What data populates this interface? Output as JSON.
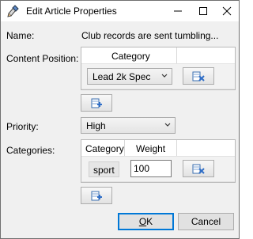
{
  "window": {
    "title": "Edit Article Properties",
    "controls": {
      "minimize": "minimize",
      "maximize": "maximize",
      "close": "close"
    }
  },
  "form": {
    "name_label": "Name:",
    "name_value": "Club records are sent tumbling...",
    "content_position_label": "Content Position:",
    "priority_label": "Priority:",
    "categories_label": "Categories:"
  },
  "content_position": {
    "column_header": "Category",
    "selected": "Lead 2k Spec"
  },
  "priority": {
    "selected": "High"
  },
  "categories": {
    "columns": [
      "Category",
      "Weight"
    ],
    "rows": [
      {
        "category": "sport",
        "weight": "100"
      }
    ]
  },
  "buttons": {
    "ok_mnemonic": "O",
    "ok_rest": "K",
    "cancel": "Cancel"
  },
  "icons": {
    "app": "puzzle-pencil-icon",
    "add": "add-row-icon",
    "remove": "delete-row-icon"
  }
}
